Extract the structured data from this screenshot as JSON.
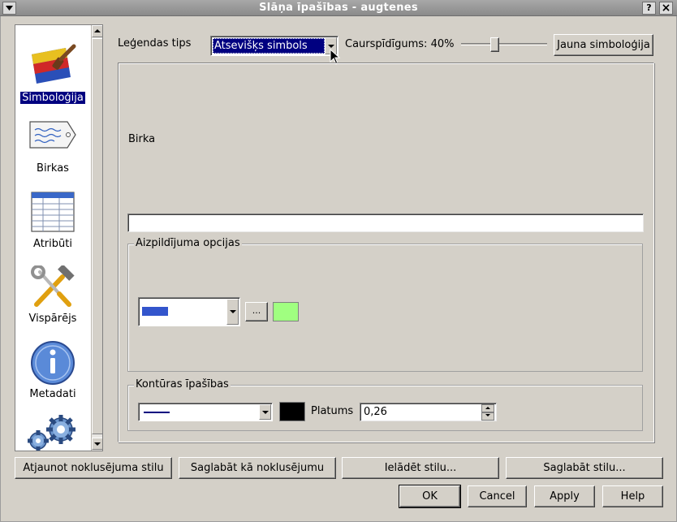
{
  "window": {
    "title": "Slāņa īpašības - augtenes",
    "help_glyph": "?",
    "close_glyph": "×"
  },
  "sidebar": {
    "items": [
      {
        "label": "Simboloģija",
        "icon": "symbology-icon",
        "selected": true
      },
      {
        "label": "Birkas",
        "icon": "label-tag-icon"
      },
      {
        "label": "Atribūti",
        "icon": "attribute-table-icon"
      },
      {
        "label": "Vispārējs",
        "icon": "tools-icon"
      },
      {
        "label": "Metadati",
        "icon": "info-icon"
      },
      {
        "label": "",
        "icon": "gears-icon"
      }
    ]
  },
  "toolbar": {
    "legend_type_label": "Leģendas tips",
    "legend_type_value": "Atsevišķs simbols",
    "transparency_label": "Caurspīdīgums: 40%",
    "transparency_fraction": 0.4,
    "new_symbology_button": "Jauna simboloģija"
  },
  "panel": {
    "label_title": "Birka",
    "label_value": "",
    "fill_group": {
      "title": "Aizpildījuma opcijas",
      "pattern_color": "#3355cc",
      "more_button": "...",
      "fill_color": "#a0ff80"
    },
    "outline_group": {
      "title": "Kontūras īpašības",
      "line_color": "#000080",
      "outline_color": "#000000",
      "width_label": "Platums",
      "width_value": "0,26"
    }
  },
  "style_buttons": {
    "restore_default": "Atjaunot noklusējuma stilu",
    "save_as_default": "Saglabāt kā noklusējumu",
    "load_style": "Ielādēt stilu...",
    "save_style": "Saglabāt stilu..."
  },
  "dialog_buttons": {
    "ok": "OK",
    "cancel": "Cancel",
    "apply": "Apply",
    "help": "Help"
  }
}
